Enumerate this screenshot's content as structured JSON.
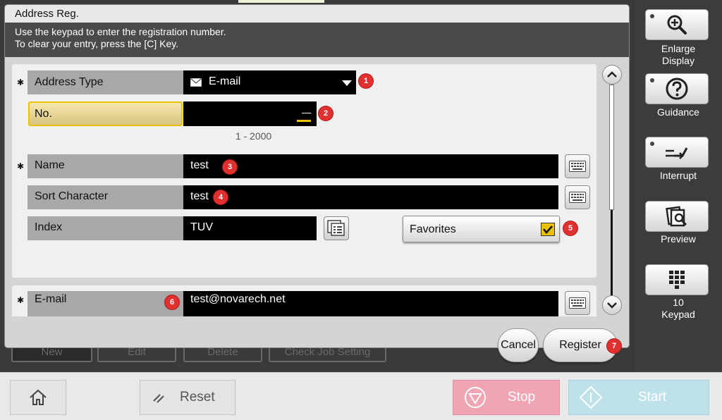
{
  "background": {
    "buttons": [
      "New",
      "Edit",
      "Delete",
      "Check Job Setting"
    ]
  },
  "dialog": {
    "title": "Address Reg.",
    "instructions": [
      "Use the keypad to enter the registration number.",
      "To clear your entry, press the [C] Key."
    ],
    "required_mark": "✱",
    "fields": {
      "address_type": {
        "label": "Address Type",
        "value": "E-mail",
        "icon": "envelope-icon",
        "badge": "1"
      },
      "number": {
        "label": "No.",
        "value": "----",
        "range": "1 - 2000",
        "badge": "2"
      },
      "name": {
        "label": "Name",
        "value": "test",
        "badge": "3"
      },
      "sort_character": {
        "label": "Sort Character",
        "value": "test",
        "badge": "4"
      },
      "index": {
        "label": "Index",
        "value": "TUV"
      },
      "favorites": {
        "label": "Favorites",
        "checked": true,
        "badge": "5"
      },
      "email": {
        "label": "E-mail",
        "value": "test@novarech.net",
        "badge": "6"
      }
    },
    "buttons": {
      "cancel": "Cancel",
      "register": "Register",
      "register_badge": "7"
    }
  },
  "side_panel": {
    "enlarge_display": [
      "Enlarge",
      "Display"
    ],
    "guidance": "Guidance",
    "interrupt": "Interrupt",
    "preview": "Preview",
    "keypad": [
      "10",
      "Keypad"
    ]
  },
  "bottom_bar": {
    "reset": "Reset",
    "stop": "Stop",
    "start": "Start"
  },
  "colors": {
    "badge": "#e03030",
    "stop_bg": "#f0a5b5",
    "start_bg": "#bfe2ea",
    "number_focus": "#e8c200"
  }
}
